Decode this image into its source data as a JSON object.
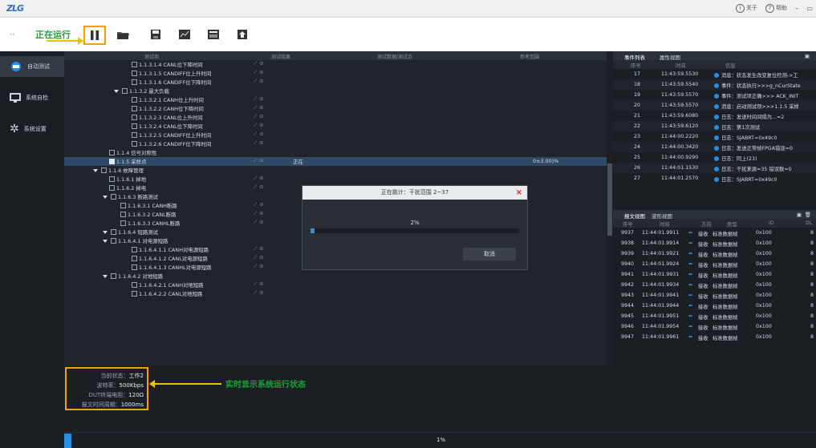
{
  "app": {
    "logo": "ZLG",
    "links": {
      "about": "关于",
      "help": "帮助",
      "about_icon": "i",
      "help_icon": "?"
    }
  },
  "toolbar": {
    "running_annotation": "正在运行"
  },
  "sidebar": {
    "items": [
      {
        "label": "自动测试",
        "icon": "robot-icon",
        "active": true
      },
      {
        "label": "系统自检",
        "icon": "monitor-icon",
        "active": false
      },
      {
        "label": "系统设置",
        "icon": "gear-icon",
        "active": false
      }
    ]
  },
  "tree": {
    "columns": [
      "测试项",
      "测试结果",
      "测试数据/测试点",
      "参考范围"
    ],
    "rows": [
      {
        "label": "1.1.3.1.4 CANL位下降时间",
        "level": 5,
        "check": true,
        "expand": false
      },
      {
        "label": "1.1.3.1.5 CANDIFF位上升时间",
        "level": 5,
        "check": true,
        "expand": false
      },
      {
        "label": "1.1.3.1.6 CANDIFF位下降时间",
        "level": 5,
        "check": true,
        "expand": false
      },
      {
        "label": "1.1.3.2 最大负载",
        "level": 4,
        "check": true,
        "expand": true
      },
      {
        "label": "1.1.3.2.1 CANH位上升时间",
        "level": 5,
        "check": true,
        "expand": false
      },
      {
        "label": "1.1.3.2.2 CANH位下降时间",
        "level": 5,
        "check": true,
        "expand": false
      },
      {
        "label": "1.1.3.2.3 CANL位上升时间",
        "level": 5,
        "check": true,
        "expand": false
      },
      {
        "label": "1.1.3.2.4 CANL位下降时间",
        "level": 5,
        "check": true,
        "expand": false
      },
      {
        "label": "1.1.3.2.5 CANDIFF位上升时间",
        "level": 5,
        "check": true,
        "expand": false
      },
      {
        "label": "1.1.3.2.6 CANDIFF位下降时间",
        "level": 5,
        "check": true,
        "expand": false
      },
      {
        "label": "1.1.4 信号对称性",
        "level": 2,
        "check": true,
        "expand": false
      },
      {
        "label": "1.1.5 采样点",
        "level": 2,
        "check": true,
        "expand": false,
        "selected": true,
        "result": "正在",
        "range": "0±3.00)%"
      },
      {
        "label": "1.1.6 故障管理",
        "level": 1,
        "check": true,
        "expand": true
      },
      {
        "label": "1.1.6.1 掉地",
        "level": 3,
        "check": true,
        "expand": false
      },
      {
        "label": "1.1.6.2 掉电",
        "level": 3,
        "check": true,
        "expand": false
      },
      {
        "label": "1.1.6.3 断路测试",
        "level": 2,
        "check": true,
        "expand": true
      },
      {
        "label": "1.1.6.3.1 CANH断路",
        "level": 4,
        "check": true,
        "expand": false
      },
      {
        "label": "1.1.6.3.2 CANL断路",
        "level": 4,
        "check": true,
        "expand": false
      },
      {
        "label": "1.1.6.3.3 CANHL断路",
        "level": 4,
        "check": true,
        "expand": false
      },
      {
        "label": "1.1.6.4 短路测试",
        "level": 2,
        "check": true,
        "expand": true
      },
      {
        "label": "1.1.6.4.1 对电源短路",
        "level": 3,
        "check": true,
        "expand": true
      },
      {
        "label": "1.1.6.4.1.1 CANH对电源短路",
        "level": 5,
        "check": true,
        "expand": false
      },
      {
        "label": "1.1.6.4.1.2 CANL对电源短路",
        "level": 5,
        "check": true,
        "expand": false
      },
      {
        "label": "1.1.6.4.1.3 CANHL对电源短路",
        "level": 5,
        "check": true,
        "expand": false
      },
      {
        "label": "1.1.6.4.2 对地短路",
        "level": 3,
        "check": true,
        "expand": true
      },
      {
        "label": "1.1.6.4.2.1 CANH对地短路",
        "level": 5,
        "check": true,
        "expand": false
      },
      {
        "label": "1.1.6.4.2.2 CANL对地短路",
        "level": 5,
        "check": true,
        "expand": false
      }
    ]
  },
  "status": {
    "lines": [
      {
        "k": "当前状态：",
        "v": "工作2"
      },
      {
        "k": "波特率：",
        "v": "500Kbps"
      },
      {
        "k": "DUT终端电阻：",
        "v": "120Ω"
      },
      {
        "k": "报文时间周期：",
        "v": "1000ms"
      }
    ],
    "annotation": "实时显示系统运行状态"
  },
  "progress": {
    "label": "1%",
    "fraction": 0.01
  },
  "dialog": {
    "title": "正在跳计：干扰范围 2~37",
    "percent": "2%",
    "fraction": 0.02,
    "cancel": "取消",
    "close": "×"
  },
  "events": {
    "tabs": [
      "事件列表",
      "属性视图"
    ],
    "columns": [
      "序号",
      "时间",
      "信息"
    ],
    "rows": [
      {
        "no": "17",
        "time": "11:43:59.5530",
        "info": "消息：状态发生改变复位检测->工"
      },
      {
        "no": "18",
        "time": "11:43:59.5540",
        "info": "事件：状态执行>>>g_nCurState"
      },
      {
        "no": "19",
        "time": "11:43:59.5570",
        "info": "事件：测试项正确>>> ACK_INIT"
      },
      {
        "no": "20",
        "time": "11:43:59.5570",
        "info": "消息：启动测试项>>>1.1.5 采样"
      },
      {
        "no": "21",
        "time": "11:43:59.6080",
        "info": "日志：发送时间间隔为...=2"
      },
      {
        "no": "22",
        "time": "11:43:59.6120",
        "info": "日志：第1次测试"
      },
      {
        "no": "23",
        "time": "11:44:00.2220",
        "info": "日志：SJABRT=0x49c0"
      },
      {
        "no": "24",
        "time": "11:44:00.3420",
        "info": "日志：发送正常帧FPGA错误=0"
      },
      {
        "no": "25",
        "time": "11:44:00.9290",
        "info": "日志：同上(23)"
      },
      {
        "no": "26",
        "time": "11:44:01.1530",
        "info": "日志：干扰来源=35 错误数=0"
      },
      {
        "no": "27",
        "time": "11:44:01.2570",
        "info": "日志：SJABRT=0x49c0"
      }
    ]
  },
  "messages": {
    "tabs": [
      "报文视图",
      "波形视图"
    ],
    "columns": [
      "序号",
      "时间",
      "方向",
      "类型",
      "ID",
      "DL"
    ],
    "rows": [
      {
        "no": "9937",
        "time": "11:44:01.9911",
        "dir": "接收",
        "type": "标准数据帧",
        "id": "0x100",
        "dl": "8"
      },
      {
        "no": "9938",
        "time": "11:44:01.9914",
        "dir": "接收",
        "type": "标准数据帧",
        "id": "0x100",
        "dl": "8"
      },
      {
        "no": "9939",
        "time": "11:44:01.9921",
        "dir": "接收",
        "type": "标准数据帧",
        "id": "0x100",
        "dl": "8"
      },
      {
        "no": "9940",
        "time": "11:44:01.9924",
        "dir": "接收",
        "type": "标准数据帧",
        "id": "0x100",
        "dl": "8"
      },
      {
        "no": "9941",
        "time": "11:44:01.9931",
        "dir": "接收",
        "type": "标准数据帧",
        "id": "0x100",
        "dl": "8"
      },
      {
        "no": "9942",
        "time": "11:44:01.9934",
        "dir": "接收",
        "type": "标准数据帧",
        "id": "0x100",
        "dl": "8"
      },
      {
        "no": "9943",
        "time": "11:44:01.9941",
        "dir": "接收",
        "type": "标准数据帧",
        "id": "0x100",
        "dl": "8"
      },
      {
        "no": "9944",
        "time": "11:44:01.9944",
        "dir": "接收",
        "type": "标准数据帧",
        "id": "0x100",
        "dl": "8"
      },
      {
        "no": "9945",
        "time": "11:44:01.9951",
        "dir": "接收",
        "type": "标准数据帧",
        "id": "0x100",
        "dl": "8"
      },
      {
        "no": "9946",
        "time": "11:44:01.9954",
        "dir": "接收",
        "type": "标准数据帧",
        "id": "0x100",
        "dl": "8"
      },
      {
        "no": "9947",
        "time": "11:44:01.9961",
        "dir": "接收",
        "type": "标准数据帧",
        "id": "0x100",
        "dl": "8"
      }
    ]
  },
  "colors": {
    "accent": "#2a8de0",
    "annotation": "#18a33a",
    "highlight": "#f5a000",
    "close": "#e0262d"
  }
}
